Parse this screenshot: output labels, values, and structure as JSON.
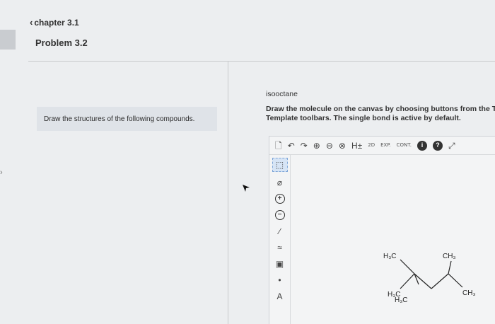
{
  "nav": {
    "breadcrumb": "chapter 3.1",
    "problem_title": "Problem 3.2"
  },
  "left": {
    "instruction": "Draw the structures of the following compounds."
  },
  "right": {
    "compound_name": "isooctane",
    "instructions_line1": "Draw the molecule on the canvas by choosing buttons from the T",
    "instructions_line2": "Template toolbars. The single bond is active by default."
  },
  "toolbar_top": [
    {
      "name": "new-doc-icon",
      "glyph": "🗋"
    },
    {
      "name": "undo-icon",
      "glyph": "↶"
    },
    {
      "name": "redo-icon",
      "glyph": "↷"
    },
    {
      "name": "zoom-in-icon",
      "glyph": "⊕"
    },
    {
      "name": "zoom-out-icon",
      "glyph": "⊖"
    },
    {
      "name": "clear-icon",
      "glyph": "⊗"
    },
    {
      "name": "hydrogen-icon",
      "glyph": "H±"
    },
    {
      "name": "2d-icon",
      "glyph": "2D"
    },
    {
      "name": "exp-icon",
      "glyph": "EXP."
    },
    {
      "name": "cont-icon",
      "glyph": "CONT."
    },
    {
      "name": "info-icon",
      "glyph": "i"
    },
    {
      "name": "help-icon",
      "glyph": "?"
    },
    {
      "name": "expand-icon",
      "glyph": "⤢"
    }
  ],
  "toolbar_left": [
    {
      "name": "select-icon",
      "glyph": "⬚"
    },
    {
      "name": "eraser-icon",
      "glyph": "⌀"
    },
    {
      "name": "positive-charge-icon",
      "glyph": "+"
    },
    {
      "name": "negative-charge-icon",
      "glyph": "−"
    },
    {
      "name": "single-bond-icon",
      "glyph": "∕"
    },
    {
      "name": "chain-icon",
      "glyph": "≈"
    },
    {
      "name": "template-icon",
      "glyph": "▣"
    },
    {
      "name": "radical-icon",
      "glyph": "•"
    },
    {
      "name": "atom-label-icon",
      "glyph": "A"
    }
  ],
  "molecule": {
    "labels": {
      "h3c_top": "H₃C",
      "ch3_top": "CH₃",
      "ch3_right": "CH₃",
      "h3c_bottom_a": "H₃C",
      "h3c_bottom_b": "H₃C"
    }
  },
  "colors": {
    "active_tool": "#d6e4f5",
    "bond": "#222222"
  }
}
